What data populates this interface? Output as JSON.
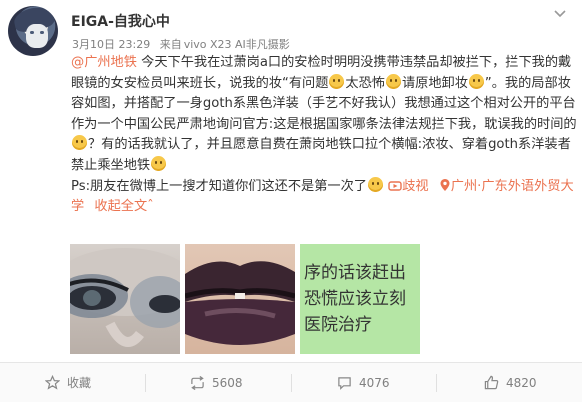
{
  "post": {
    "username": "EIGA-自我心中",
    "date": "3月10日 23:29",
    "source_prefix": "来自",
    "source": "vivo X23 AI非凡摄影",
    "mention": "@广州地铁",
    "text1": " 今天下午我在过萧岗a口的安检时明明没携带违禁品却被拦下，拦下我的戴眼镜的女安检员叫来班长，说我的妆“有问题",
    "text2": "太恐怖",
    "text3": "请原地卸妆",
    "text4": "”。我的局部妆容如图，并搭配了一身goth系黑色洋装（手艺不好我认）我想通过这个相对公开的平台作为一个中国公民严肃地询问官方:这是根据国家哪条法律法规拦下我，耽误我的时间的",
    "text5": "？有的话我就认了，并且愿意自费在萧岗地铁口拉个横幅:浓妆、穿着goth系洋装者禁止乘坐地铁",
    "text6": "Ps:朋友在微博上一搜才知道你们这还不是第一次了",
    "video_label": "歧视",
    "location_label": "广州·广东外语外贸大学",
    "collapse_label": "收起全文",
    "collapse_arrow": "ˆ",
    "image3_text": "序的话该赶出\n恐慌应该立刻\n医院治疗"
  },
  "actions": {
    "favorite": "收藏",
    "repost": "5608",
    "comment": "4076",
    "like": "4820"
  },
  "colors": {
    "link": "#eb7350",
    "meta": "#808080"
  },
  "icons": [
    "chevron-down-icon",
    "emoji-face-icon",
    "video-icon",
    "location-pin-icon",
    "star-icon",
    "repost-icon",
    "comment-icon",
    "thumbs-up-icon"
  ]
}
